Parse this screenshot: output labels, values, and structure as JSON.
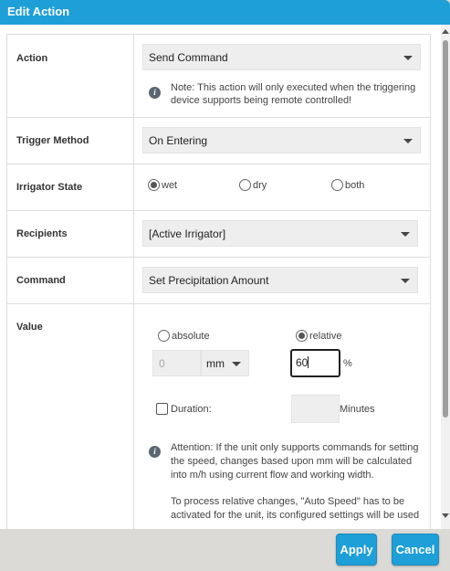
{
  "dialog": {
    "title": "Edit Action"
  },
  "rows": {
    "action": {
      "label": "Action",
      "selected": "Send Command",
      "note": "Note: This action will only executed when the triggering device supports being remote controlled!"
    },
    "trigger_method": {
      "label": "Trigger Method",
      "selected": "On Entering"
    },
    "irrigator_state": {
      "label": "Irrigator State",
      "options": [
        "wet",
        "dry",
        "both"
      ],
      "selected": "wet"
    },
    "recipients": {
      "label": "Recipients",
      "selected": "[Active Irrigator]"
    },
    "command": {
      "label": "Command",
      "selected": "Set Precipitation Amount"
    },
    "value": {
      "label": "Value",
      "mode_options": [
        "absolute",
        "relative"
      ],
      "mode_selected": "relative",
      "absolute_value": "0",
      "unit_selected": "mm",
      "relative_value": "60",
      "relative_unit": "%",
      "duration_label": "Duration:",
      "duration_checked": false,
      "duration_value": "",
      "duration_unit": "Minutes",
      "attention_text": "Attention: If the unit only supports commands for setting the speed, changes based upon mm will be calculated into m/h using current flow and working width.",
      "attention_text_2": "To process relative changes, \"Auto Speed\" has to be activated for the unit, its configured settings will be used"
    }
  },
  "footer": {
    "apply_label": "Apply",
    "cancel_label": "Cancel"
  },
  "colors": {
    "accent": "#1e9fd8",
    "footer_bg": "#dcdad6",
    "field_bg": "#eeeeee"
  }
}
